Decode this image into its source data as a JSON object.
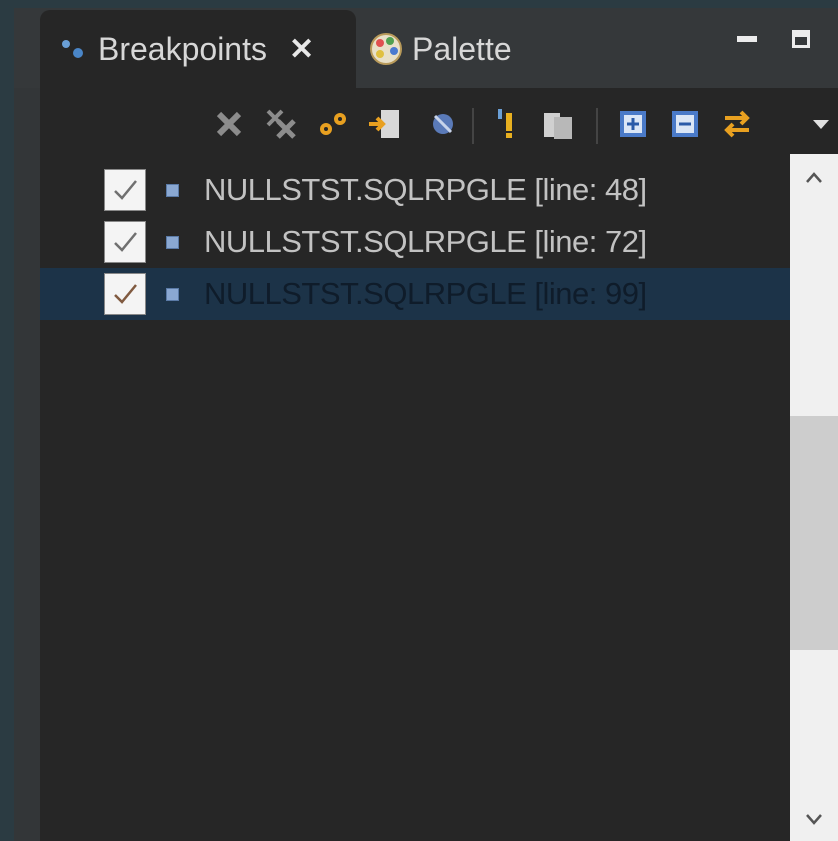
{
  "tabs": [
    {
      "label": "Breakpoints",
      "icon": "breakpoints-icon",
      "active": true,
      "close_symbol": "✕"
    },
    {
      "label": "Palette",
      "icon": "palette-icon",
      "active": false
    }
  ],
  "window_controls": [
    "minimize-icon",
    "maximize-icon"
  ],
  "toolbar": {
    "buttons": [
      "remove-breakpoint-icon",
      "remove-all-breakpoints-icon",
      "show-breakpoints-supported-icon",
      "go-to-file-icon",
      "skip-all-breakpoints-icon",
      "add-exception-breakpoint-icon",
      "group-by-icon",
      "expand-all-icon",
      "collapse-all-icon",
      "link-with-debug-view-icon",
      "view-menu-icon"
    ]
  },
  "breakpoints": [
    {
      "label": "NULLSTST.SQLRPGLE [line: 48]",
      "checked": true,
      "selected": false
    },
    {
      "label": "NULLSTST.SQLRPGLE [line: 72]",
      "checked": true,
      "selected": false
    },
    {
      "label": "NULLSTST.SQLRPGLE [line: 99]",
      "checked": true,
      "selected": true
    }
  ],
  "colors": {
    "background": "#262626",
    "selection": "#1c3348",
    "text": "#c2c2c2",
    "breakpoint_marker": "#8aa8d2"
  }
}
